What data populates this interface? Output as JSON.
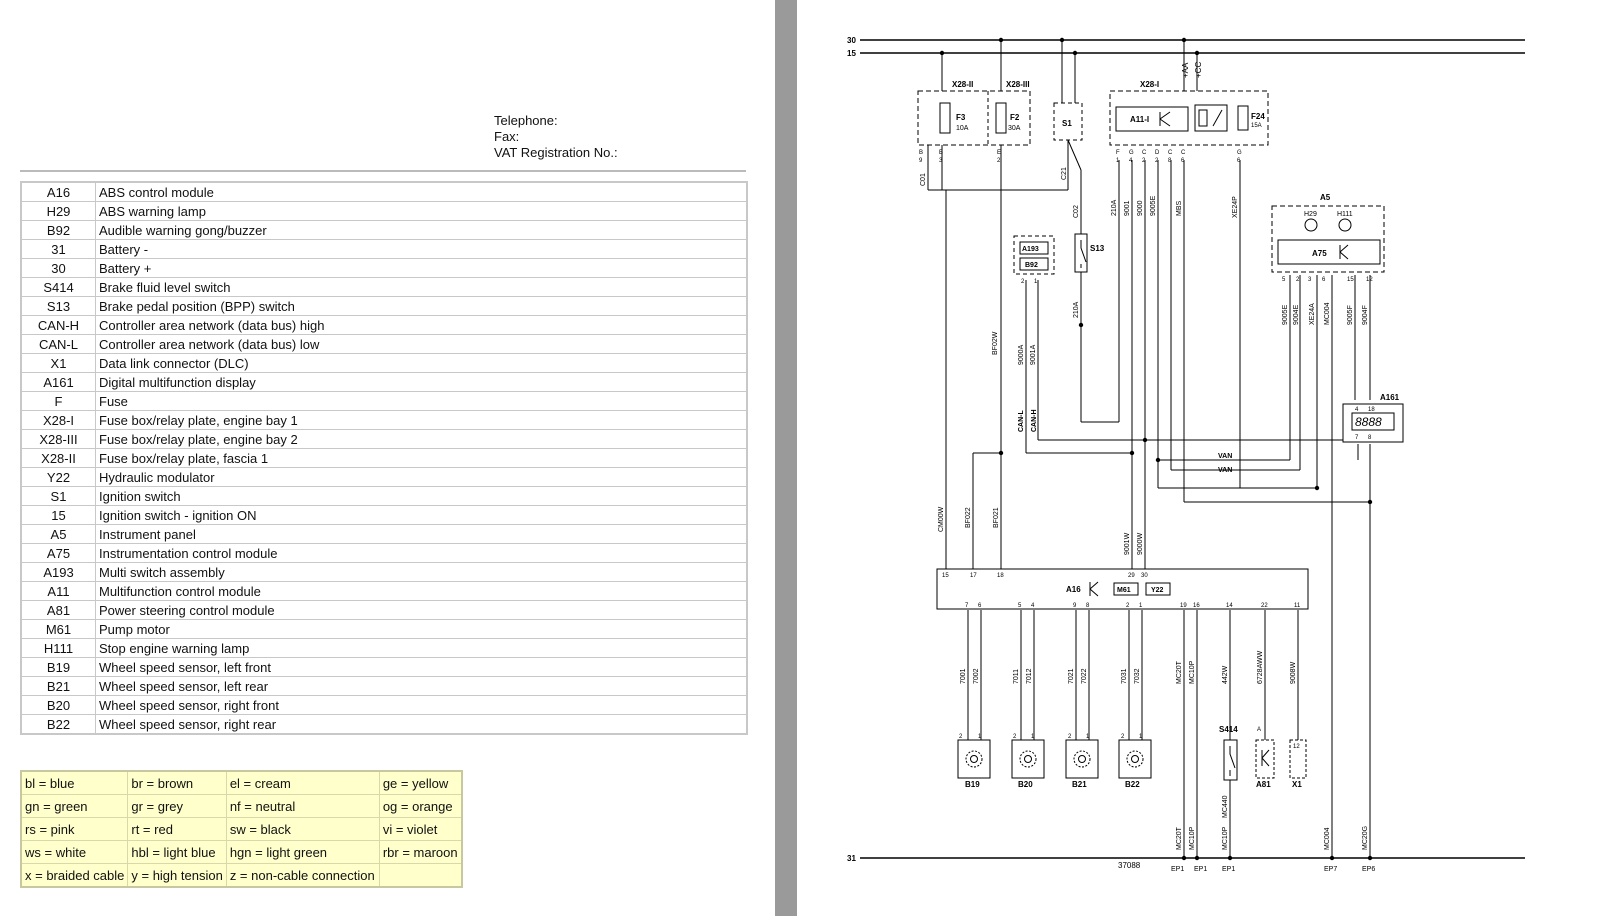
{
  "contact": {
    "telephone": "Telephone:",
    "fax": "Fax:",
    "vat": "VAT Registration No.:"
  },
  "legend": [
    {
      "code": "A16",
      "desc": "ABS control module"
    },
    {
      "code": "H29",
      "desc": "ABS warning lamp"
    },
    {
      "code": "B92",
      "desc": "Audible warning gong/buzzer"
    },
    {
      "code": "31",
      "desc": "Battery -"
    },
    {
      "code": "30",
      "desc": "Battery +"
    },
    {
      "code": "S414",
      "desc": "Brake fluid level switch"
    },
    {
      "code": "S13",
      "desc": "Brake pedal position (BPP) switch"
    },
    {
      "code": "CAN-H",
      "desc": "Controller area network (data bus) high"
    },
    {
      "code": "CAN-L",
      "desc": "Controller area network (data bus) low"
    },
    {
      "code": "X1",
      "desc": "Data link connector (DLC)"
    },
    {
      "code": "A161",
      "desc": "Digital multifunction display"
    },
    {
      "code": "F",
      "desc": "Fuse"
    },
    {
      "code": "X28-I",
      "desc": "Fuse box/relay plate, engine bay 1"
    },
    {
      "code": "X28-III",
      "desc": "Fuse box/relay plate, engine bay 2"
    },
    {
      "code": "X28-II",
      "desc": "Fuse box/relay plate, fascia 1"
    },
    {
      "code": "Y22",
      "desc": "Hydraulic modulator"
    },
    {
      "code": "S1",
      "desc": "Ignition switch"
    },
    {
      "code": "15",
      "desc": "Ignition switch - ignition ON"
    },
    {
      "code": "A5",
      "desc": "Instrument panel"
    },
    {
      "code": "A75",
      "desc": "Instrumentation control module"
    },
    {
      "code": "A193",
      "desc": "Multi switch assembly"
    },
    {
      "code": "A11",
      "desc": "Multifunction control module"
    },
    {
      "code": "A81",
      "desc": "Power steering control module"
    },
    {
      "code": "M61",
      "desc": "Pump motor"
    },
    {
      "code": "H111",
      "desc": "Stop engine warning lamp"
    },
    {
      "code": "B19",
      "desc": "Wheel speed sensor, left front"
    },
    {
      "code": "B21",
      "desc": "Wheel speed sensor, left rear"
    },
    {
      "code": "B20",
      "desc": "Wheel speed sensor, right front"
    },
    {
      "code": "B22",
      "desc": "Wheel speed sensor, right rear"
    }
  ],
  "color_codes": [
    [
      "bl = blue",
      "br = brown",
      "el = cream",
      "ge = yellow"
    ],
    [
      "gn = green",
      "gr = grey",
      "nf = neutral",
      "og = orange"
    ],
    [
      "rs = pink",
      "rt = red",
      "sw = black",
      "vi = violet"
    ],
    [
      "ws = white",
      "hbl = light blue",
      "hgn = light green",
      "rbr = maroon"
    ],
    [
      "x = braided cable",
      "y = high tension",
      "z = non-cable connection",
      ""
    ]
  ],
  "diagram": {
    "rails": {
      "r30": "30",
      "r15": "15",
      "r31": "31"
    },
    "diagram_number": "37088",
    "supply_labels": {
      "aa": "+AA",
      "cc": "+CC"
    },
    "components": {
      "x28ii": "X28-II",
      "x28iii": "X28-III",
      "x28i": "X28-I",
      "f3": "F3",
      "f3_rating": "10A",
      "f2": "F2",
      "f2_rating": "30A",
      "f24": "F24",
      "f24_rating": "15A",
      "s1": "S1",
      "a11": "A11-I",
      "a193": "A193",
      "b92": "B92",
      "s13": "S13",
      "a5": "A5",
      "h29": "H29",
      "h111": "H111",
      "a75": "A75",
      "a161": "A161",
      "a16": "A16",
      "m61": "M61",
      "y22": "Y22",
      "b19": "B19",
      "b20": "B20",
      "b21": "B21",
      "b22": "B22",
      "s414": "S414",
      "a81": "A81",
      "x1": "X1"
    },
    "bus_labels": {
      "can_l": "CAN-L",
      "can_h": "CAN-H",
      "van1": "VAN",
      "van2": "VAN"
    },
    "display_digits": "8888",
    "wire_labels": {
      "c01": "C01",
      "c21": "C21",
      "c02": "C02",
      "bf02w": "BF02W",
      "cm00w": "CM00W",
      "bf022": "BF022",
      "bf021": "BF021",
      "w210a_a": "210A",
      "w210a_b": "210A",
      "w9001": "9001",
      "w9000": "9000",
      "w9005e": "9005E",
      "mbs": "MBS",
      "xe24p": "XE24P",
      "w9000a": "9000A",
      "w9001a": "9001A",
      "a75_9005e": "9005E",
      "a75_9004e": "9004E",
      "a75_xe24a": "XE24A",
      "a75_mc004": "MC004",
      "a75_9005f": "9005F",
      "a75_9004f": "9004F",
      "w9001w": "9001W",
      "w9000w": "9000W",
      "w7001": "7001",
      "w7002": "7002",
      "w7011": "7011",
      "w7012": "7012",
      "w7021": "7021",
      "w7022": "7022",
      "w7031": "7031",
      "w7032": "7032",
      "mc20t": "MC20T",
      "mc10p": "MC10P",
      "w442w": "442W",
      "w6728aww": "6728AWW",
      "w9008w": "9008W",
      "g_mc20t": "MC20T",
      "g_mc10p": "MC10P",
      "g_mc10p2": "MC10P",
      "g_mc440": "MC440",
      "g_mc004": "MC004",
      "g_mc20g": "MC20G"
    },
    "pins": {
      "x28ii_1": "B",
      "x28ii_1n": "9",
      "x28ii_2": "B",
      "x28ii_2n": "3",
      "x28iii_1": "E",
      "x28iii_1n": "2",
      "x28i_f": "F",
      "x28i_f1": "1",
      "x28i_g1": "G",
      "x28i_g1n": "4",
      "x28i_c": "C",
      "x28i_cn": "2",
      "x28i_d": "D",
      "x28i_dn": "2",
      "x28i_e": "C",
      "x28i_en": "8",
      "x28i_g2": "C",
      "x28i_g2n": "6",
      "x28i_h": "D",
      "x28i_hn": "6",
      "x28i_j": "G",
      "x28i_jn": "6",
      "a5_5": "5",
      "a5_2": "2",
      "a5_3": "3",
      "a5_6": "6",
      "a5_15": "15",
      "a5_12": "12",
      "a161_4": "4",
      "a161_18": "18",
      "a161_7": "7",
      "a161_8": "8",
      "a193_2": "2",
      "a193_1": "1",
      "a16_15": "15",
      "a16_17": "17",
      "a16_18": "18",
      "a16_29": "29",
      "a16_30": "30",
      "a16_7": "7",
      "a16_6": "6",
      "a16_5": "5",
      "a16_4": "4",
      "a16_9": "9",
      "a16_8": "8",
      "a16_2": "2",
      "a16_1": "1",
      "a16_19": "19",
      "a16_16": "16",
      "a16_14": "14",
      "a16_22": "22",
      "a16_11": "11",
      "b19_2": "2",
      "b19_1": "1",
      "b20_2": "2",
      "b20_1": "1",
      "b21_2": "2",
      "b21_1": "1",
      "b22_2": "2",
      "b22_1": "1",
      "s414_a": "1",
      "a81_a": "A",
      "x1_12": "12"
    },
    "earth_labels": [
      "EP1",
      "EP1",
      "EP1",
      "EP7",
      "EP6"
    ]
  }
}
